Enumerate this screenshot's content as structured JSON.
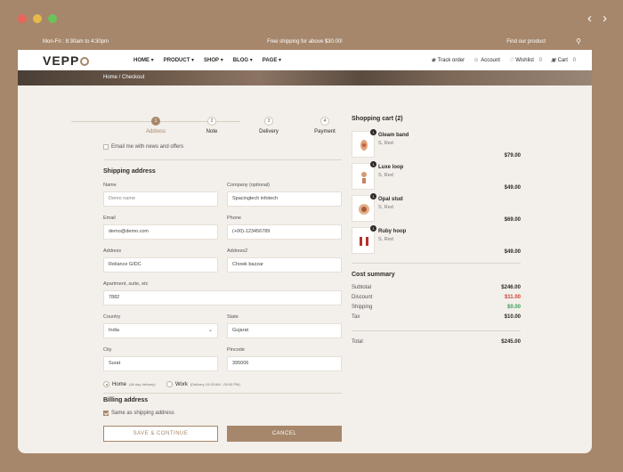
{
  "colors": {
    "accent": "#a6876b",
    "discount": "#d0403a",
    "free": "#3aa05a",
    "dot_red": "#e8655a",
    "dot_yellow": "#e7b84a",
    "dot_green": "#6bc35a"
  },
  "topbar": {
    "hours": "Mon-Fri : 8:30am to 4:30pm",
    "promo": "Free shipping for above $30.00!",
    "find": "Find our product"
  },
  "logo": "VEPP",
  "nav": {
    "items": [
      "HOME",
      "PRODUCT",
      "SHOP",
      "BLOG",
      "PAGE"
    ]
  },
  "actions": {
    "track": "Track order",
    "account": "Account",
    "wishlist": "Wishlist",
    "wishlist_count": "0",
    "cart": "Cart",
    "cart_count": "0"
  },
  "breadcrumb": "Home / Checkout",
  "steps": [
    {
      "num": "1",
      "label": "Address"
    },
    {
      "num": "2",
      "label": "Note"
    },
    {
      "num": "3",
      "label": "Delivery"
    },
    {
      "num": "4",
      "label": "Payment"
    }
  ],
  "email_opt": "Email me with news and offers",
  "shipping": {
    "title": "Shipping address",
    "name_label": "Name",
    "name_placeholder": "Demo name",
    "company_label": "Company (optional)",
    "company_value": "Spacingtech infotech",
    "email_label": "Email",
    "email_value": "demo@demo.com",
    "phone_label": "Phone",
    "phone_value": "(+00)-123456789",
    "address_label": "Address",
    "address_value": "Reliance GIDC",
    "address2_label": "Address2",
    "address2_value": "Chowk bazzar",
    "apt_label": "Apartment, suite, etc",
    "apt_value": "7882",
    "country_label": "Country",
    "country_value": "India",
    "state_label": "State",
    "state_value": "Gujarat",
    "city_label": "City",
    "city_value": "Surat",
    "pincode_label": "Pincode",
    "pincode_value": "395006",
    "home_label": "Home",
    "home_sub": "(All day delivery)",
    "work_label": "Work",
    "work_sub": "(Delivery 10:00 AM - 05:00 PM)"
  },
  "billing": {
    "title": "Billing address",
    "same": "Same as shipping address"
  },
  "buttons": {
    "save": "SAVE & CONTINUE",
    "cancel": "CANCEL"
  },
  "cart": {
    "title": "Shopping cart (2)",
    "items": [
      {
        "qty": "1",
        "name": "Gleam band",
        "variant": "S, Red",
        "price": "$79.00"
      },
      {
        "qty": "1",
        "name": "Luxe loop",
        "variant": "S, Red",
        "price": "$49.00"
      },
      {
        "qty": "1",
        "name": "Opal stud",
        "variant": "S, Red",
        "price": "$69.00"
      },
      {
        "qty": "1",
        "name": "Ruby hoop",
        "variant": "S, Red",
        "price": "$49.00"
      }
    ]
  },
  "cost": {
    "title": "Cost summary",
    "subtotal_label": "Subtotal",
    "subtotal": "$246.00",
    "discount_label": "Discount",
    "discount": "$11.00",
    "shipping_label": "Shipping",
    "shipping": "$0.00",
    "tax_label": "Tax",
    "tax": "$10.00",
    "total_label": "Total",
    "total": "$245.00"
  }
}
